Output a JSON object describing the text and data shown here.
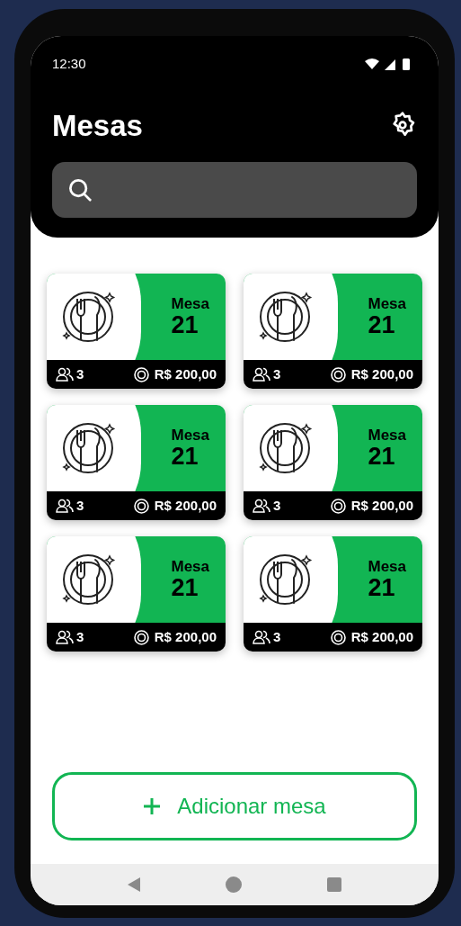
{
  "status_bar": {
    "time": "12:30"
  },
  "header": {
    "title": "Mesas"
  },
  "tables": [
    {
      "label": "Mesa",
      "number": "21",
      "guests": "3",
      "amount": "R$ 200,00"
    },
    {
      "label": "Mesa",
      "number": "21",
      "guests": "3",
      "amount": "R$ 200,00"
    },
    {
      "label": "Mesa",
      "number": "21",
      "guests": "3",
      "amount": "R$ 200,00"
    },
    {
      "label": "Mesa",
      "number": "21",
      "guests": "3",
      "amount": "R$ 200,00"
    },
    {
      "label": "Mesa",
      "number": "21",
      "guests": "3",
      "amount": "R$ 200,00"
    },
    {
      "label": "Mesa",
      "number": "21",
      "guests": "3",
      "amount": "R$ 200,00"
    }
  ],
  "add_button": {
    "label": "Adicionar mesa"
  }
}
